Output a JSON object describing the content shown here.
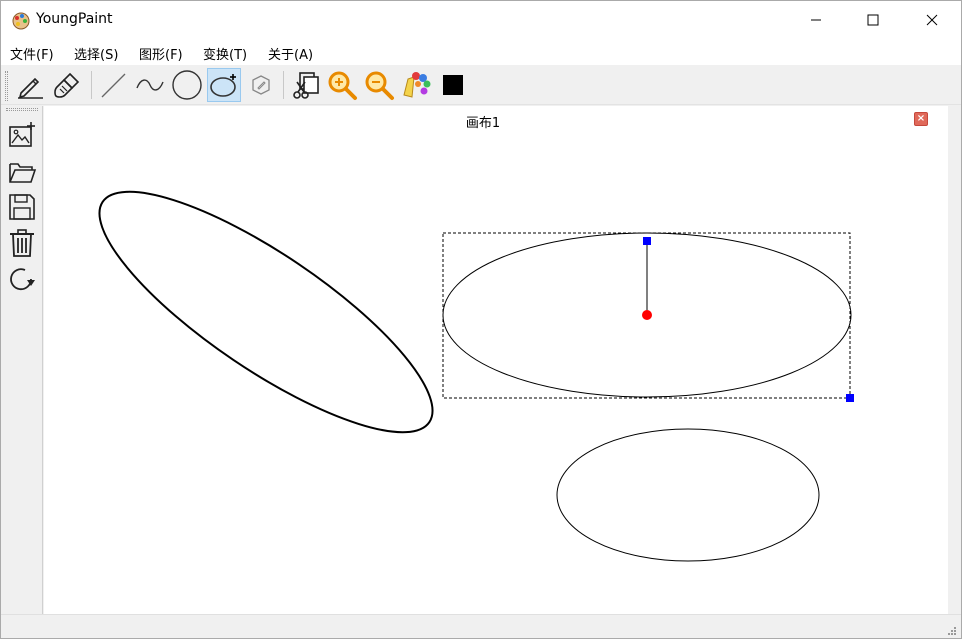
{
  "window": {
    "title": "YoungPaint",
    "minimize_icon": "minimize-icon",
    "maximize_icon": "maximize-icon",
    "close_icon": "close-icon"
  },
  "menu": [
    {
      "label": "文件(F)"
    },
    {
      "label": "选择(S)"
    },
    {
      "label": "图形(F)"
    },
    {
      "label": "变换(T)"
    },
    {
      "label": "关于(A)"
    }
  ],
  "toolbar": {
    "tools": [
      {
        "icon": "pencil-icon"
      },
      {
        "icon": "brush-icon"
      },
      {
        "icon": "line-icon"
      },
      {
        "icon": "curve-icon"
      },
      {
        "icon": "circle-icon"
      },
      {
        "icon": "ellipse-icon",
        "selected": true
      },
      {
        "icon": "polygon-icon"
      },
      {
        "icon": "clip-icon"
      },
      {
        "icon": "zoom-in-icon"
      },
      {
        "icon": "zoom-out-icon"
      },
      {
        "icon": "palette-icon"
      },
      {
        "icon": "color-swatch-icon",
        "color": "#000000"
      }
    ]
  },
  "sidebar": {
    "buttons": [
      {
        "icon": "new-image-icon"
      },
      {
        "icon": "open-folder-icon"
      },
      {
        "icon": "save-icon"
      },
      {
        "icon": "delete-icon"
      },
      {
        "icon": "redo-icon"
      }
    ]
  },
  "canvas": {
    "tab_title": "画布1",
    "tab_close_icon": "close-icon",
    "selection_handle_color": "#0000ff",
    "rotation_center_color": "#ff0000"
  }
}
